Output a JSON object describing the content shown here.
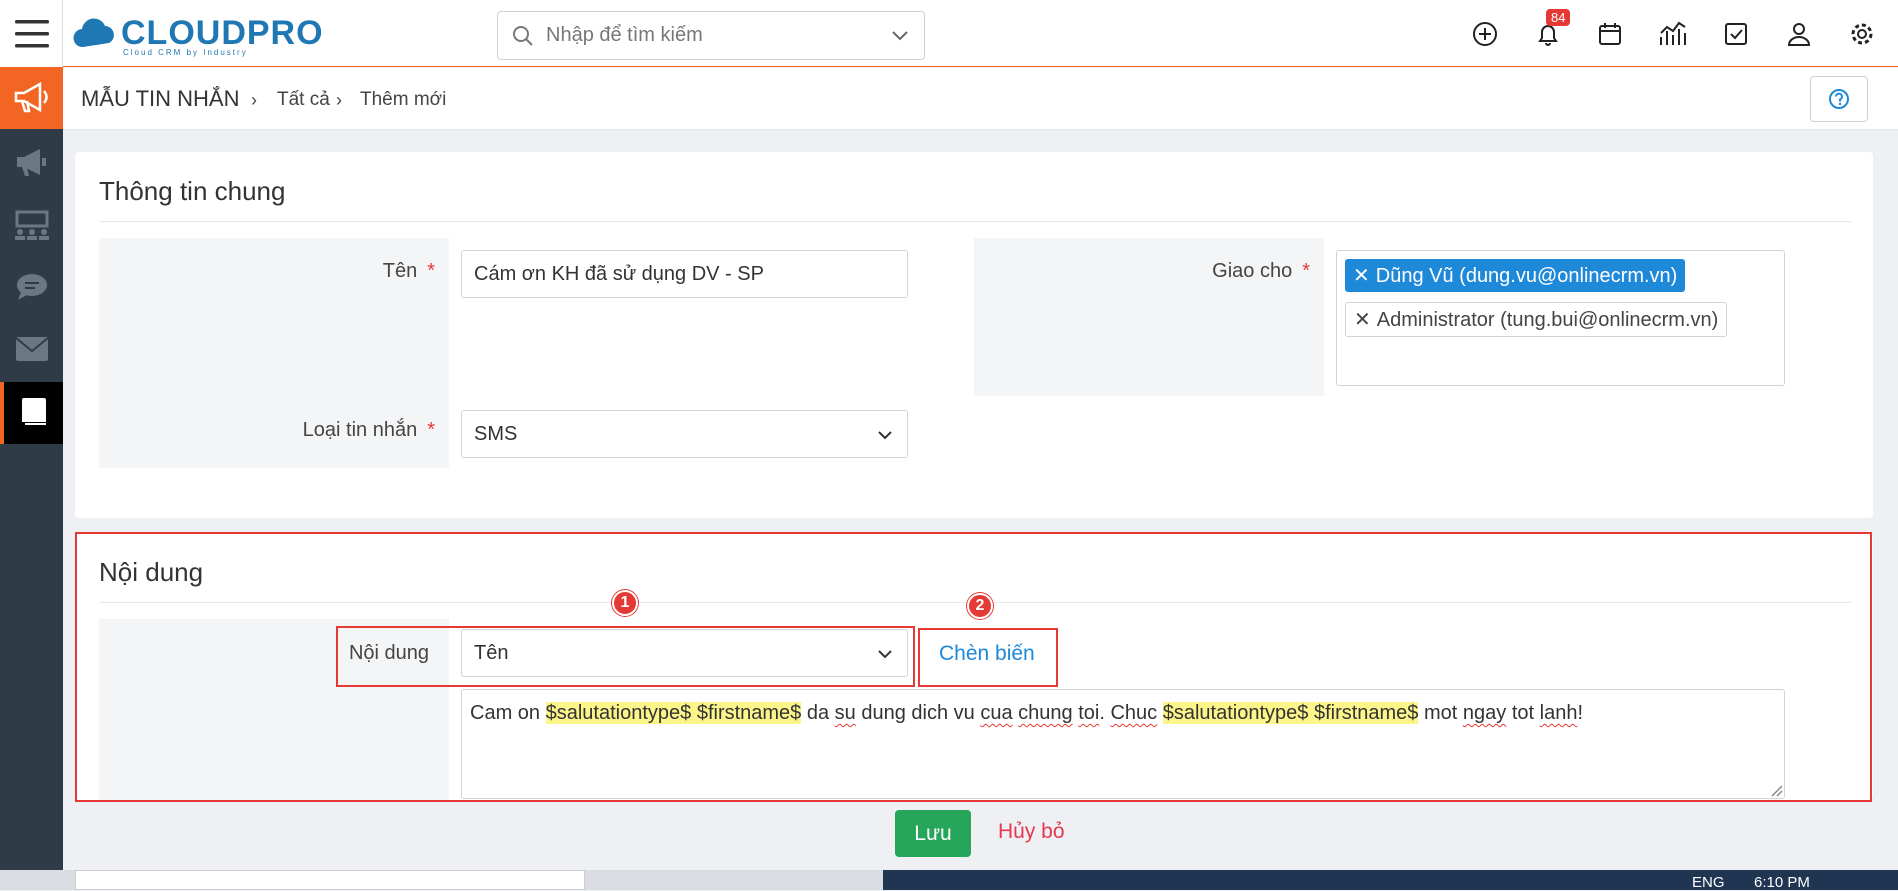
{
  "topbar": {
    "logo_text": "CLOUDPRO",
    "logo_tagline": "Cloud CRM by Industry",
    "search_placeholder": "Nhập để tìm kiếm",
    "notification_count": "84"
  },
  "breadcrumb": {
    "module": "MẪU TIN NHẮN",
    "level1": "Tất cả",
    "level2": "Thêm mới"
  },
  "general": {
    "title": "Thông tin chung",
    "name_label": "Tên",
    "name_value": "Cám ơn KH đã sử dụng DV - SP",
    "type_label": "Loại tin nhắn",
    "type_value": "SMS",
    "assign_label": "Giao cho",
    "assignees": [
      "Dũng Vũ (dung.vu@onlinecrm.vn)",
      "Administrator (tung.bui@onlinecrm.vn)"
    ]
  },
  "content": {
    "title": "Nội dung",
    "field_label": "Nội dung",
    "variable_select": "Tên",
    "insert_button": "Chèn biến",
    "marker1": "1",
    "marker2": "2",
    "text": {
      "p1": "Cam on ",
      "v1": "$salutationtype$ $firstname$",
      "p2": " da ",
      "w_su": "su",
      "p3": " dung dich vu ",
      "w_cua": "cua",
      "p4": " ",
      "w_chung": "chung",
      "p5": " ",
      "w_toi": "toi",
      "p6": ". ",
      "w_chuc": "Chuc",
      "p7": " ",
      "v2": "$salutationtype$ $firstname$",
      "p8": " mot ",
      "w_ngay": "ngay",
      "p9": " tot ",
      "w_lanh": "lanh",
      "p10": "!"
    }
  },
  "actions": {
    "save": "Lưu",
    "cancel": "Hủy bỏ"
  },
  "taskbar": {
    "lang": "ENG",
    "time": "6:10 PM"
  },
  "colors": {
    "accent_orange": "#f26522",
    "brand_blue": "#1f77b4",
    "save_green": "#26a65b",
    "annotation_red": "#e53935"
  }
}
